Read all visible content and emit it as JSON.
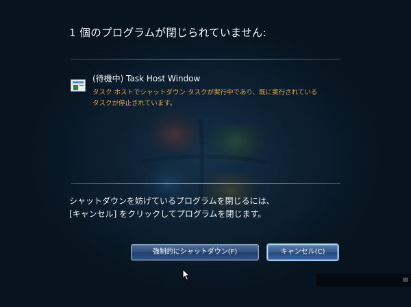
{
  "dialog": {
    "title": "1 個のプログラムが閉じられていません:"
  },
  "program": {
    "icon": "task-host-window-icon",
    "name": "(待機中) Task Host Window",
    "status_line1": "タスク ホストでシャットダウン タスクが実行中であり、既に実行されている",
    "status_line2": "タスクが停止されています。"
  },
  "instructions": {
    "line1": "シャットダウンを妨げているプログラムを閉じるには、",
    "line2": "[キャンセル] をクリックしてプログラムを閉じます。"
  },
  "buttons": {
    "force_shutdown": "強制的にシャットダウン(F)",
    "cancel": "キャンセル(C)"
  },
  "colors": {
    "background": "#0e2235",
    "warning_text": "#e9a84b",
    "button": "#2f4d7a"
  }
}
